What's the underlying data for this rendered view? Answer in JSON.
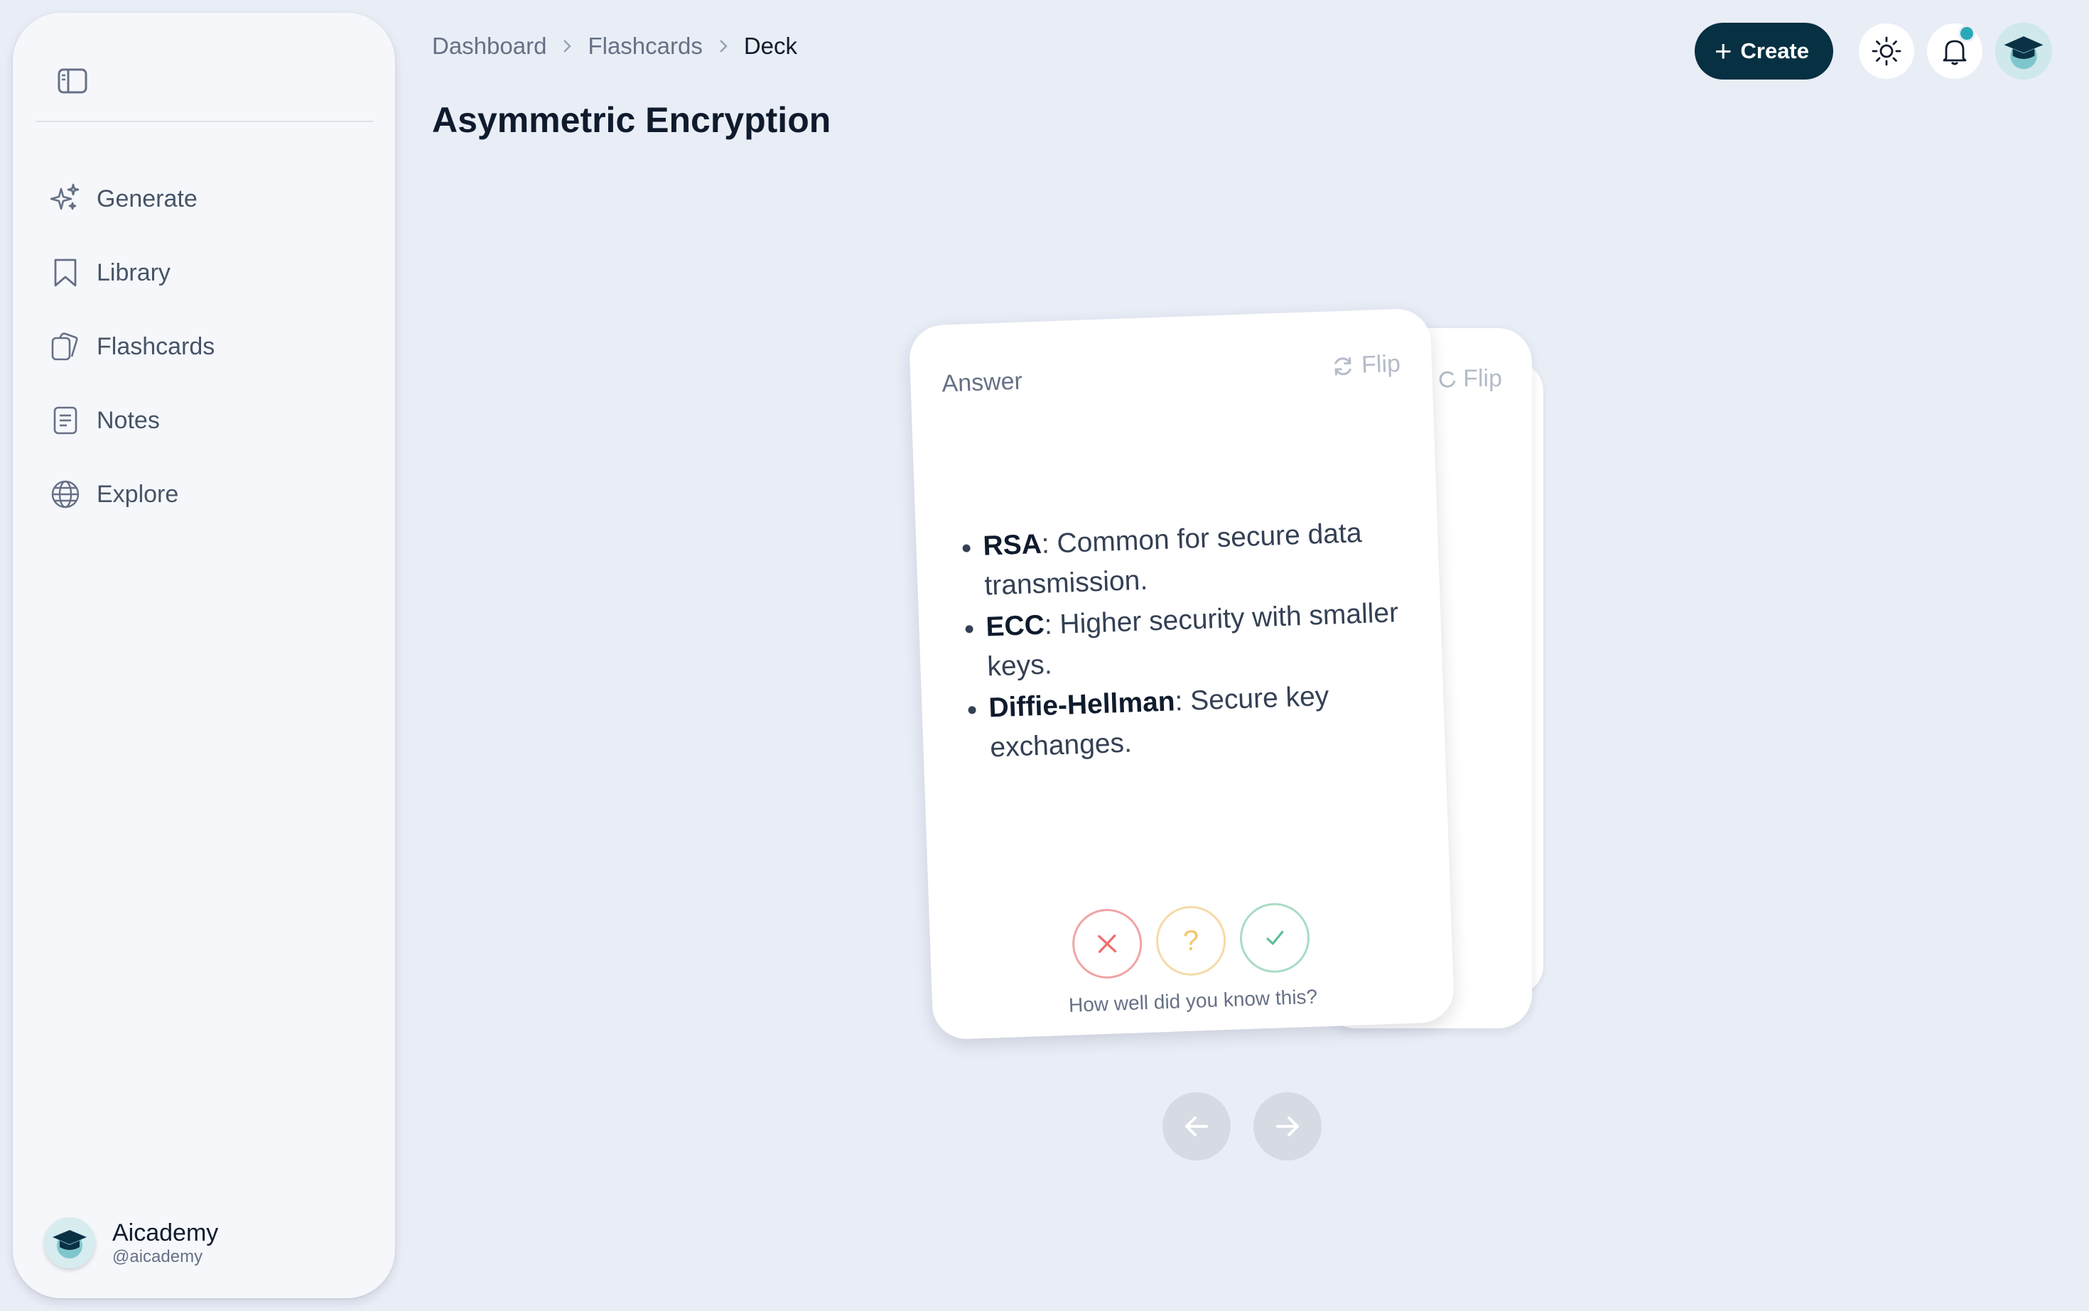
{
  "sidebar": {
    "items": [
      {
        "label": "Generate",
        "icon": "sparkles-icon"
      },
      {
        "label": "Library",
        "icon": "bookmark-icon"
      },
      {
        "label": "Flashcards",
        "icon": "cards-icon"
      },
      {
        "label": "Notes",
        "icon": "notes-icon"
      },
      {
        "label": "Explore",
        "icon": "globe-icon"
      }
    ],
    "profile": {
      "name": "Aicademy",
      "handle": "@aicademy"
    }
  },
  "breadcrumb": [
    "Dashboard",
    "Flashcards",
    "Deck"
  ],
  "page": {
    "title": "Asymmetric Encryption"
  },
  "toolbar": {
    "create_label": "Create"
  },
  "card": {
    "side_label": "Answer",
    "flip_label": "Flip",
    "items": [
      {
        "term": "RSA",
        "desc": ": Common for secure data transmission."
      },
      {
        "term": "ECC",
        "desc": ": Higher security with smaller keys."
      },
      {
        "term": "Diffie-Hellman",
        "desc": ": Secure key exchanges."
      }
    ],
    "rating_question": "How well did you know this?",
    "rating_unsure_symbol": "?"
  },
  "colors": {
    "accent": "#073042",
    "background": "#e9edf6",
    "wrong": "#ef6b6b",
    "unsure": "#f2c86b",
    "right": "#5cbf95"
  }
}
